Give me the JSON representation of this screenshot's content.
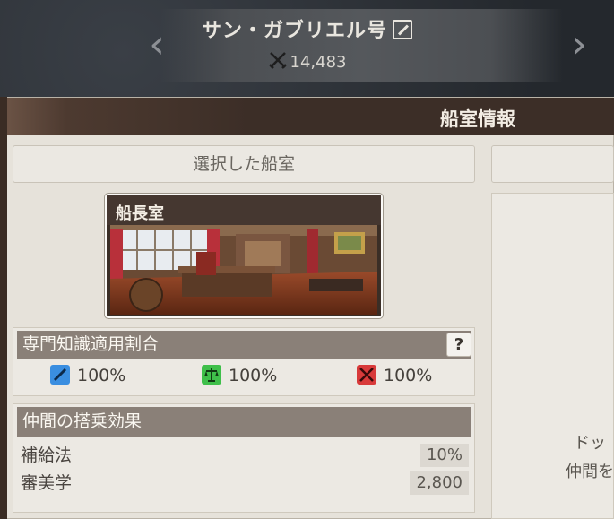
{
  "ship": {
    "name": "サン・ガブリエル号",
    "power": "14,483"
  },
  "panel": {
    "title": "船室情報",
    "selected_label": "選択した船室",
    "right_text_line1": "ドッ",
    "right_text_line2": "仲間を"
  },
  "cabin": {
    "name": "船長室"
  },
  "expertise": {
    "title": "専門知識適用割合",
    "help": "?",
    "stats": [
      {
        "icon": "quill-icon",
        "color": "#3a8ee0",
        "value": "100%"
      },
      {
        "icon": "scales-icon",
        "color": "#3fbf4a",
        "value": "100%"
      },
      {
        "icon": "crossed-swords-icon",
        "color": "#d83a3a",
        "value": "100%"
      }
    ]
  },
  "crew": {
    "title": "仲間の搭乗効果",
    "rows": [
      {
        "label": "補給法",
        "value": "10%"
      },
      {
        "label": "審美学",
        "value": "2,800"
      }
    ]
  }
}
